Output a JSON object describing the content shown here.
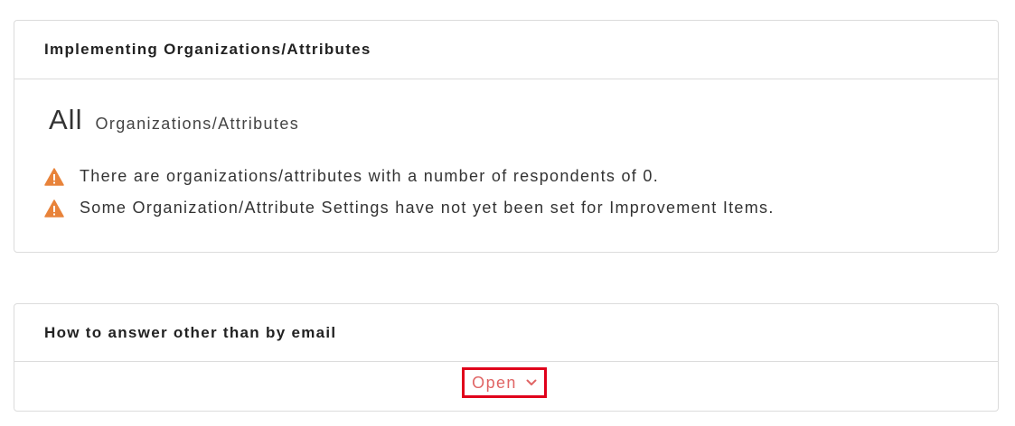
{
  "section_org": {
    "title": "Implementing Organizations/Attributes",
    "all_label": "All",
    "all_sub": "Organizations/Attributes",
    "warnings": [
      "There are organizations/attributes with a number of respondents of 0.",
      "Some Organization/Attribute Settings have not yet been set for Improvement Items."
    ],
    "warning_icon": "warning-triangle-icon",
    "warning_color": "#e8833a"
  },
  "section_answer": {
    "title": "How to answer other than by email",
    "open_label": "Open",
    "open_icon": "chevron-down-icon",
    "open_color": "#e06565",
    "highlight_color": "#e0001b"
  }
}
